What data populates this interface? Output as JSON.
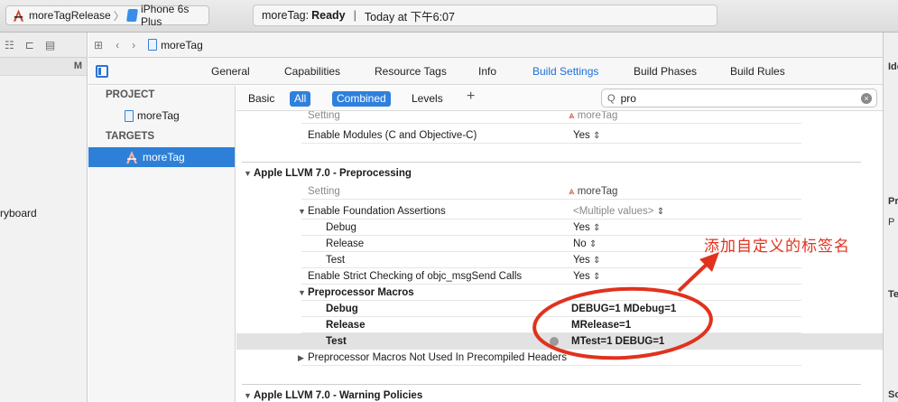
{
  "toolbar": {
    "scheme": "moreTagRelease",
    "device": "iPhone 6s Plus",
    "status_project": "moreTag:",
    "status_state": "Ready",
    "status_time": "Today at 下午6:07"
  },
  "navigator": {
    "column_letter": "M",
    "partial_item": "ryboard"
  },
  "jumpbar": {
    "file": "moreTag"
  },
  "editor_tabs": [
    "General",
    "Capabilities",
    "Resource Tags",
    "Info",
    "Build Settings",
    "Build Phases",
    "Build Rules"
  ],
  "active_tab": "Build Settings",
  "targets_list": {
    "project_header": "PROJECT",
    "project_item": "moreTag",
    "targets_header": "TARGETS",
    "target_item": "moreTag"
  },
  "filter": {
    "basic": "Basic",
    "all": "All",
    "combined": "Combined",
    "levels": "Levels",
    "add": "+",
    "search_value": "pro"
  },
  "settings": {
    "col_setting": "Setting",
    "col_target": "moreTag",
    "enable_modules": "Enable Modules (C and Objective-C)",
    "enable_modules_val": "Yes",
    "section_preprocessing": "Apple LLVM 7.0 - Preprocessing",
    "col_setting2": "Setting",
    "col_target2": "moreTag",
    "foundation_assertions": "Enable Foundation Assertions",
    "foundation_assertions_val": "<Multiple values>",
    "debug": "Debug",
    "debug_val": "Yes",
    "release": "Release",
    "release_val": "No",
    "test": "Test",
    "test_val": "Yes",
    "strict_checking": "Enable Strict Checking of objc_msgSend Calls",
    "strict_checking_val": "Yes",
    "preprocessor_macros": "Preprocessor Macros",
    "macro_debug": "Debug",
    "macro_debug_val": "DEBUG=1  MDebug=1",
    "macro_release": "Release",
    "macro_release_val": "MRelease=1",
    "macro_test": "Test",
    "macro_test_val": "MTest=1 DEBUG=1",
    "not_used_macros": "Preprocessor Macros Not Used In Precompiled Headers",
    "section_warnings": "Apple LLVM 7.0 - Warning Policies"
  },
  "inspector": {
    "a": "Ide",
    "b": "Pr",
    "c": "P",
    "d": "Te",
    "e": "So"
  },
  "annotation": {
    "text": "添加自定义的标签名",
    "color": "#e0321e"
  },
  "colors": {
    "accent": "#2f80dd",
    "selection": "#2d7fd8",
    "annotation": "#e0321e"
  },
  "icons": [
    "xcode-app-icon",
    "iphone-icon",
    "grid-icon",
    "back-arrow-icon",
    "forward-arrow-icon",
    "file-icon",
    "sidebar-toggle-icon",
    "search-icon",
    "clear-icon"
  ]
}
